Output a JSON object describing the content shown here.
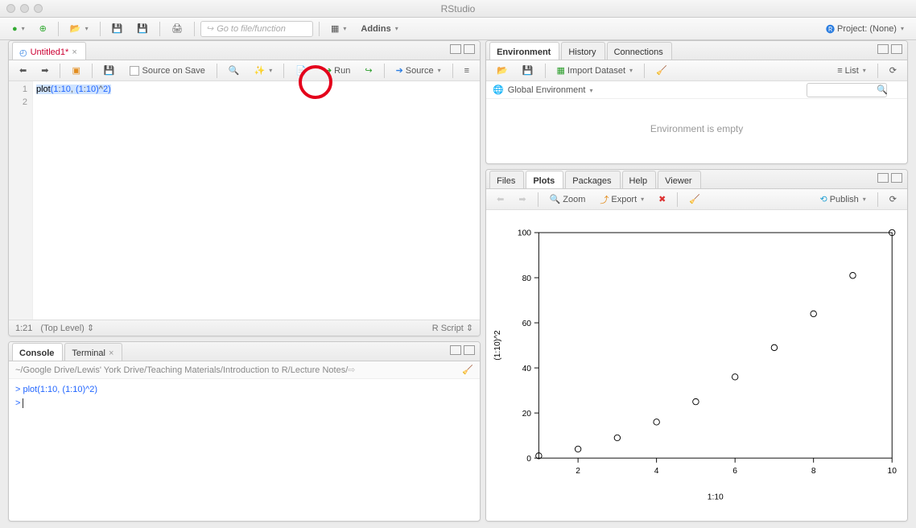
{
  "window": {
    "title": "RStudio"
  },
  "maintoolbar": {
    "goto_placeholder": "Go to file/function",
    "addins_label": "Addins",
    "project_label": "Project: (None)"
  },
  "source_pane": {
    "tab_title": "Untitled1*",
    "source_on_save": "Source on Save",
    "run_label": "Run",
    "source_label": "Source",
    "code_line1_fn": "plot",
    "code_line1_args_a": "1",
    "code_line1_args_b": "10",
    "code_line1_args_c": "1",
    "code_line1_args_d": "10",
    "code_line1_args_e": "2",
    "status_pos": "1:21",
    "status_scope": "(Top Level) ",
    "status_lang": "R Script "
  },
  "console_pane": {
    "tab_console": "Console",
    "tab_terminal": "Terminal",
    "path": "~/Google Drive/Lewis' York Drive/Teaching Materials/Introduction to R/Lecture Notes/ ",
    "line1": "plot(1:10, (1:10)^2)"
  },
  "env_pane": {
    "tab_env": "Environment",
    "tab_history": "History",
    "tab_connections": "Connections",
    "import_label": "Import Dataset",
    "list_label": "List",
    "scope_label": "Global Environment",
    "empty_text": "Environment is empty"
  },
  "plots_pane": {
    "tab_files": "Files",
    "tab_plots": "Plots",
    "tab_packages": "Packages",
    "tab_help": "Help",
    "tab_viewer": "Viewer",
    "zoom_label": "Zoom",
    "export_label": "Export",
    "publish_label": "Publish"
  },
  "chart_data": {
    "type": "scatter",
    "x": [
      1,
      2,
      3,
      4,
      5,
      6,
      7,
      8,
      9,
      10
    ],
    "y": [
      1,
      4,
      9,
      16,
      25,
      36,
      49,
      64,
      81,
      100
    ],
    "xlabel": "1:10",
    "ylabel": "(1:10)^2",
    "xlim": [
      1,
      10
    ],
    "ylim": [
      0,
      100
    ],
    "xticks": [
      2,
      4,
      6,
      8,
      10
    ],
    "yticks": [
      0,
      20,
      40,
      60,
      80,
      100
    ]
  }
}
